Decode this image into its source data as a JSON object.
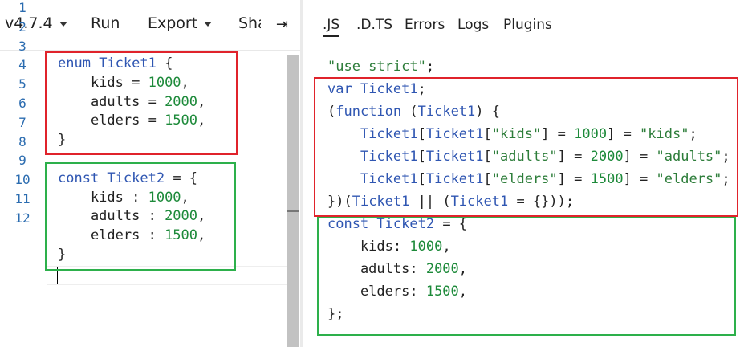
{
  "toolbar": {
    "version": "v4.7.4",
    "run": "Run",
    "export": "Export",
    "share": "Share",
    "collapse_icon": "collapse-right-arrow-icon"
  },
  "editor": {
    "line_numbers": [
      "1",
      "2",
      "3",
      "4",
      "5",
      "6",
      "7",
      "8",
      "9",
      "10",
      "11",
      "12"
    ],
    "lines": [
      [
        {
          "t": "enum ",
          "c": "kw"
        },
        {
          "t": "Ticket1",
          "c": "nm"
        },
        {
          "t": " {",
          "c": "pl"
        }
      ],
      [
        {
          "t": "    kids = ",
          "c": "pl"
        },
        {
          "t": "1000",
          "c": "num"
        },
        {
          "t": ",",
          "c": "pl"
        }
      ],
      [
        {
          "t": "    adults = ",
          "c": "pl"
        },
        {
          "t": "2000",
          "c": "num"
        },
        {
          "t": ",",
          "c": "pl"
        }
      ],
      [
        {
          "t": "    elders = ",
          "c": "pl"
        },
        {
          "t": "1500",
          "c": "num"
        },
        {
          "t": ",",
          "c": "pl"
        }
      ],
      [
        {
          "t": "}",
          "c": "pl"
        }
      ],
      [],
      [
        {
          "t": "const ",
          "c": "kw"
        },
        {
          "t": "Ticket2",
          "c": "nm"
        },
        {
          "t": " = {",
          "c": "pl"
        }
      ],
      [
        {
          "t": "    kids : ",
          "c": "pl"
        },
        {
          "t": "1000",
          "c": "num"
        },
        {
          "t": ",",
          "c": "pl"
        }
      ],
      [
        {
          "t": "    adults : ",
          "c": "pl"
        },
        {
          "t": "2000",
          "c": "num"
        },
        {
          "t": ",",
          "c": "pl"
        }
      ],
      [
        {
          "t": "    elders : ",
          "c": "pl"
        },
        {
          "t": "1500",
          "c": "num"
        },
        {
          "t": ",",
          "c": "pl"
        }
      ],
      [
        {
          "t": "}",
          "c": "pl"
        }
      ],
      []
    ]
  },
  "output": {
    "tabs": [
      ".JS",
      ".D.TS",
      "Errors",
      "Logs",
      "Plugins"
    ],
    "active_tab": ".JS",
    "lines": [
      [
        {
          "t": "\"use strict\"",
          "c": "str"
        },
        {
          "t": ";",
          "c": "pl"
        }
      ],
      [
        {
          "t": "var ",
          "c": "kw"
        },
        {
          "t": "Ticket1",
          "c": "nm"
        },
        {
          "t": ";",
          "c": "pl"
        }
      ],
      [
        {
          "t": "(",
          "c": "pl"
        },
        {
          "t": "function",
          "c": "kw"
        },
        {
          "t": " (",
          "c": "pl"
        },
        {
          "t": "Ticket1",
          "c": "nm"
        },
        {
          "t": ") {",
          "c": "pl"
        }
      ],
      [
        {
          "t": "    ",
          "c": "pl"
        },
        {
          "t": "Ticket1",
          "c": "nm"
        },
        {
          "t": "[",
          "c": "pl"
        },
        {
          "t": "Ticket1",
          "c": "nm"
        },
        {
          "t": "[",
          "c": "pl"
        },
        {
          "t": "\"kids\"",
          "c": "str"
        },
        {
          "t": "] = ",
          "c": "pl"
        },
        {
          "t": "1000",
          "c": "num"
        },
        {
          "t": "] = ",
          "c": "pl"
        },
        {
          "t": "\"kids\"",
          "c": "str"
        },
        {
          "t": ";",
          "c": "pl"
        }
      ],
      [
        {
          "t": "    ",
          "c": "pl"
        },
        {
          "t": "Ticket1",
          "c": "nm"
        },
        {
          "t": "[",
          "c": "pl"
        },
        {
          "t": "Ticket1",
          "c": "nm"
        },
        {
          "t": "[",
          "c": "pl"
        },
        {
          "t": "\"adults\"",
          "c": "str"
        },
        {
          "t": "] = ",
          "c": "pl"
        },
        {
          "t": "2000",
          "c": "num"
        },
        {
          "t": "] = ",
          "c": "pl"
        },
        {
          "t": "\"adults\"",
          "c": "str"
        },
        {
          "t": ";",
          "c": "pl"
        }
      ],
      [
        {
          "t": "    ",
          "c": "pl"
        },
        {
          "t": "Ticket1",
          "c": "nm"
        },
        {
          "t": "[",
          "c": "pl"
        },
        {
          "t": "Ticket1",
          "c": "nm"
        },
        {
          "t": "[",
          "c": "pl"
        },
        {
          "t": "\"elders\"",
          "c": "str"
        },
        {
          "t": "] = ",
          "c": "pl"
        },
        {
          "t": "1500",
          "c": "num"
        },
        {
          "t": "] = ",
          "c": "pl"
        },
        {
          "t": "\"elders\"",
          "c": "str"
        },
        {
          "t": ";",
          "c": "pl"
        }
      ],
      [
        {
          "t": "})(",
          "c": "pl"
        },
        {
          "t": "Ticket1",
          "c": "nm"
        },
        {
          "t": " || (",
          "c": "pl"
        },
        {
          "t": "Ticket1",
          "c": "nm"
        },
        {
          "t": " = {}));",
          "c": "pl"
        }
      ],
      [
        {
          "t": "const ",
          "c": "kw"
        },
        {
          "t": "Ticket2",
          "c": "nm"
        },
        {
          "t": " = {",
          "c": "pl"
        }
      ],
      [
        {
          "t": "    kids: ",
          "c": "pl"
        },
        {
          "t": "1000",
          "c": "num"
        },
        {
          "t": ",",
          "c": "pl"
        }
      ],
      [
        {
          "t": "    adults: ",
          "c": "pl"
        },
        {
          "t": "2000",
          "c": "num"
        },
        {
          "t": ",",
          "c": "pl"
        }
      ],
      [
        {
          "t": "    elders: ",
          "c": "pl"
        },
        {
          "t": "1500",
          "c": "num"
        },
        {
          "t": ",",
          "c": "pl"
        }
      ],
      [
        {
          "t": "};",
          "c": "pl"
        }
      ]
    ]
  },
  "colors": {
    "keyword": "#2f56b2",
    "number": "#1d8a3a",
    "string": "#2d7d3a",
    "highlight_red": "#e0232b",
    "highlight_green": "#2db04b"
  }
}
